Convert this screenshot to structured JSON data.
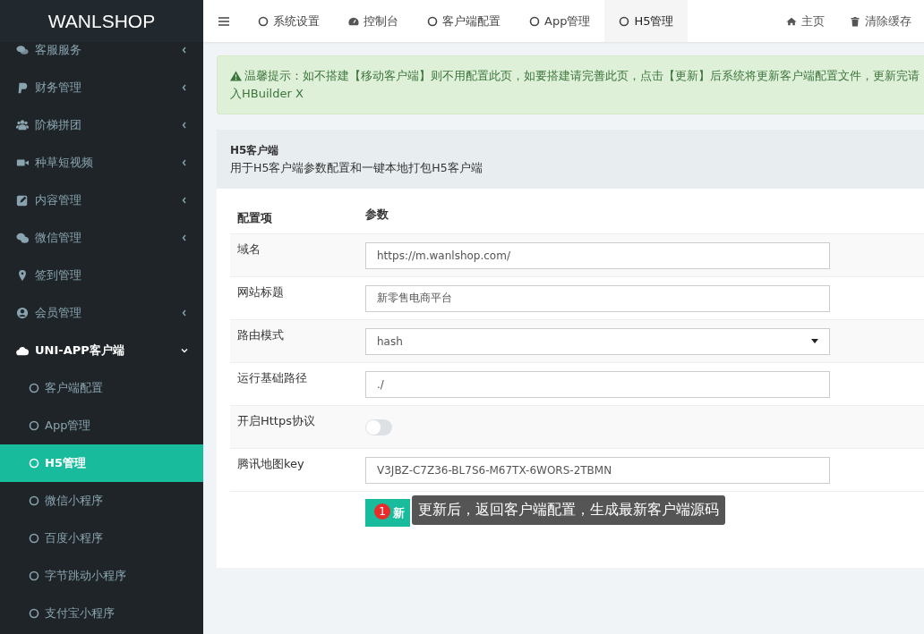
{
  "logo": "WANLSHOP",
  "sidebar": {
    "items": [
      {
        "label": "客服服务",
        "kind": "group",
        "expanded": false
      },
      {
        "label": "财务管理",
        "kind": "group",
        "expanded": false
      },
      {
        "label": "阶梯拼团",
        "kind": "group",
        "expanded": false
      },
      {
        "label": "种草短视频",
        "kind": "group",
        "expanded": false
      },
      {
        "label": "内容管理",
        "kind": "group",
        "expanded": false
      },
      {
        "label": "微信管理",
        "kind": "group",
        "expanded": false
      },
      {
        "label": "签到管理",
        "kind": "link"
      },
      {
        "label": "会员管理",
        "kind": "group",
        "expanded": false
      },
      {
        "label": "UNI-APP客户端",
        "kind": "group",
        "expanded": true,
        "children": [
          {
            "label": "客户端配置",
            "selected": false
          },
          {
            "label": "App管理",
            "selected": false
          },
          {
            "label": "H5管理",
            "selected": true
          },
          {
            "label": "微信小程序",
            "selected": false
          },
          {
            "label": "百度小程序",
            "selected": false
          },
          {
            "label": "字节跳动小程序",
            "selected": false
          },
          {
            "label": "支付宝小程序",
            "selected": false
          }
        ]
      }
    ]
  },
  "tabs": [
    {
      "label": "系统设置",
      "selected": false
    },
    {
      "label": "控制台",
      "selected": false
    },
    {
      "label": "客户端配置",
      "selected": false
    },
    {
      "label": "App管理",
      "selected": false
    },
    {
      "label": "H5管理",
      "selected": true
    }
  ],
  "top_links": [
    "主页",
    "清除缓存"
  ],
  "alert": {
    "lines": [
      "温馨提示：如不搭建【移动客户端】则不用配置此页，如要搭建请完善此页，点击【更新】后系统将更新客户端配置文件，更新完请",
      "入HBuilder X"
    ]
  },
  "panel": {
    "title": "H5客户端",
    "description": "用于H5客户端参数配置和一键本地打包H5客户端"
  },
  "table": {
    "columns": [
      "配置项",
      "参数"
    ],
    "rows": [
      {
        "label": "域名",
        "kind": "text",
        "value": "https://m.wanlshop.com/"
      },
      {
        "label": "网站标题",
        "kind": "text",
        "value": "新零售电商平台"
      },
      {
        "label": "路由模式",
        "kind": "select",
        "value": "hash"
      },
      {
        "label": "运行基础路径",
        "kind": "text",
        "value": "./"
      },
      {
        "label": "开启Https协议",
        "kind": "switch",
        "on": false
      },
      {
        "label": "腾讯地图key",
        "kind": "text",
        "value": "V3JBZ-C7Z36-BL7S6-M67TX-6WORS-2TBMN"
      }
    ]
  },
  "submit_button": {
    "label": "新",
    "badge": "1"
  },
  "tooltip": "更新后，返回客户端配置，生成最新客户端源码"
}
